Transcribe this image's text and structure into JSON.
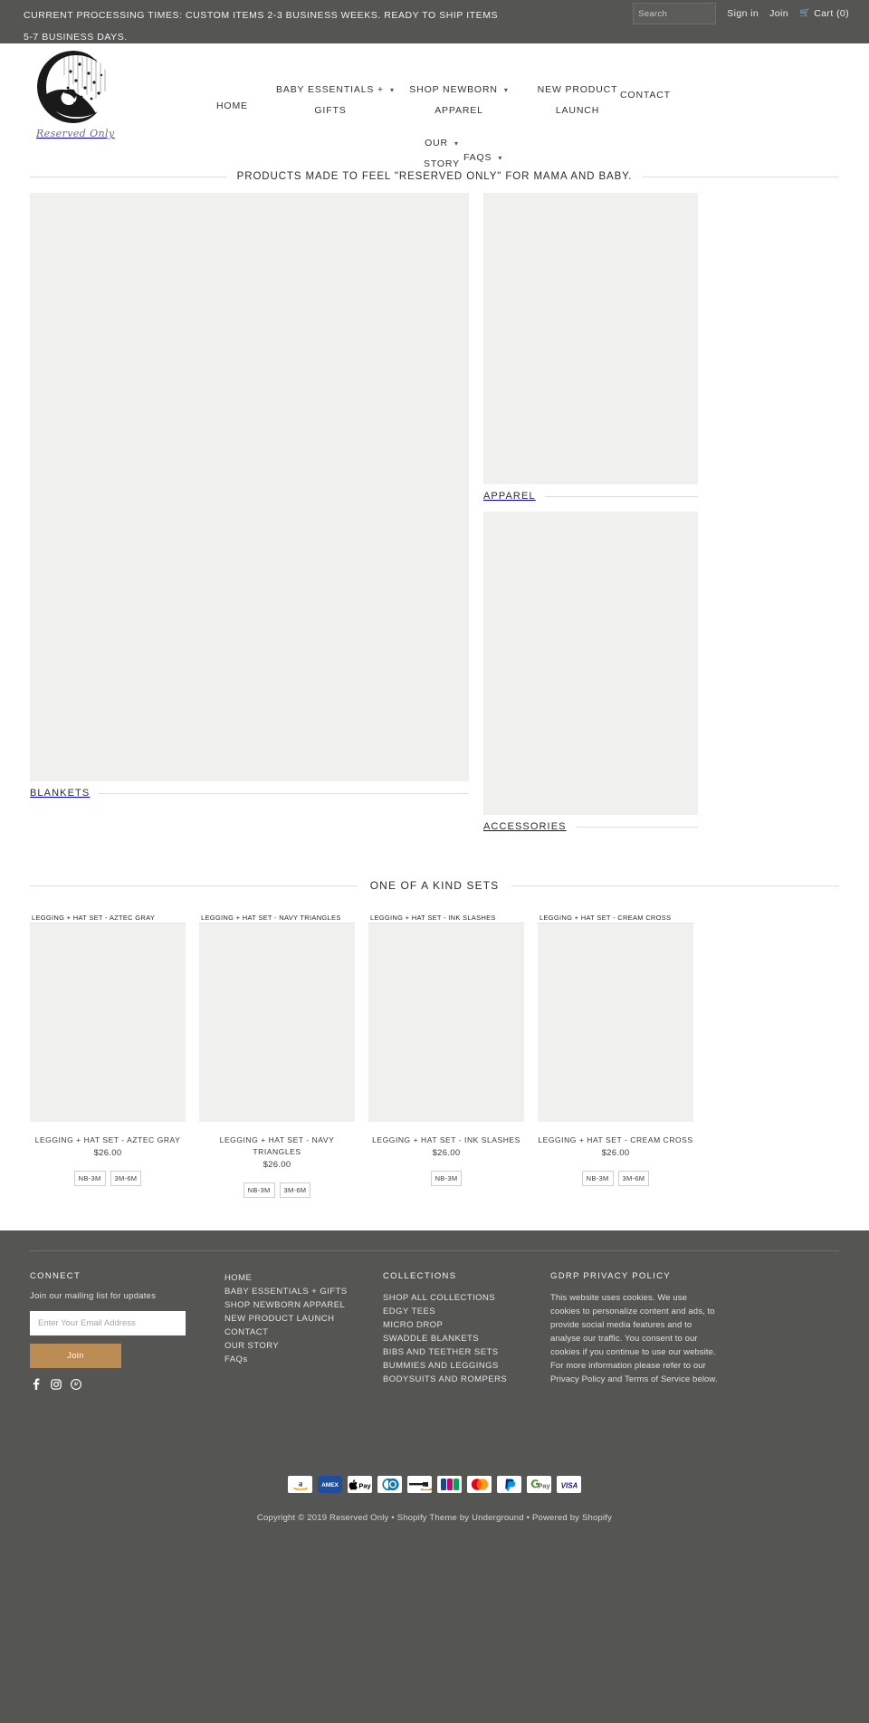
{
  "announcement": {
    "line1": "CURRENT PROCESSING TIMES: CUSTOM ITEMS 2-3 BUSINESS WEEKS. READY TO SHIP ITEMS",
    "line2": "5-7 BUSINESS DAYS.",
    "search_placeholder": "Search",
    "search_value": "",
    "sign_in": "Sign in",
    "join": "Join",
    "cart": "Cart (0)",
    "bar_color": "#555554"
  },
  "logo": {
    "script": "Reserved Only",
    "alt": "moon-and-baby-logo"
  },
  "nav": {
    "items": [
      {
        "label": "HOME",
        "caret": false
      },
      {
        "label": "BABY ESSENTIALS + GIFTS",
        "caret": true
      },
      {
        "label": "SHOP NEWBORN APPAREL",
        "caret": true
      },
      {
        "label": "NEW PRODUCT LAUNCH",
        "caret": false
      },
      {
        "label": "CONTACT",
        "caret": false
      },
      {
        "label": "OUR STORY",
        "caret": true
      },
      {
        "label": "FAQS",
        "caret": true
      }
    ]
  },
  "tagline": "PRODUCTS MADE TO FEEL \"RESERVED ONLY\" FOR MAMA AND BABY.",
  "collections": [
    {
      "label": "BLANKETS"
    },
    {
      "label": "APPAREL"
    },
    {
      "label": "ACCESSORIES"
    }
  ],
  "featured": {
    "title": "ONE OF A KIND SETS",
    "products": [
      {
        "quickview": "LEGGING + HAT SET - AZTEC GRAY",
        "title": "LEGGING + HAT SET - AZTEC GRAY",
        "price": "$26.00",
        "sizes": [
          "NB-3M",
          "3M-6M"
        ]
      },
      {
        "quickview": "LEGGING + HAT SET - NAVY TRIANGLES",
        "title": "LEGGING + HAT SET - NAVY TRIANGLES",
        "price": "$26.00",
        "sizes": [
          "NB-3M",
          "3M-6M"
        ]
      },
      {
        "quickview": "LEGGING + HAT SET - INK SLASHES",
        "title": "LEGGING + HAT SET - INK SLASHES",
        "price": "$26.00",
        "sizes": [
          "NB-3M"
        ]
      },
      {
        "quickview": "LEGGING + HAT SET - CREAM CROSS",
        "title": "LEGGING + HAT SET - CREAM CROSS",
        "price": "$26.00",
        "sizes": [
          "NB-3M",
          "3M-6M"
        ]
      }
    ]
  },
  "footer": {
    "connect": {
      "title": "CONNECT",
      "subtitle": "Join our mailing list for updates",
      "email_placeholder": "Enter Your Email Address",
      "email_value": "",
      "join_label": "Join",
      "socials": [
        "facebook-icon",
        "instagram-icon",
        "pinterest-icon"
      ]
    },
    "links": [
      "HOME",
      "BABY ESSENTIALS + GIFTS",
      "SHOP NEWBORN APPAREL",
      "NEW PRODUCT LAUNCH",
      "CONTACT",
      "OUR STORY",
      "FAQs"
    ],
    "collections": {
      "title": "COLLECTIONS",
      "items": [
        "SHOP ALL COLLECTIONS",
        "EDGY TEES",
        "MICRO DROP",
        "SWADDLE BLANKETS",
        "BIBS AND TEETHER SETS",
        "BUMMIES AND LEGGINGS",
        "BODYSUITS AND ROMPERS"
      ]
    },
    "gdpr": {
      "title": "GDRP PRIVACY POLICY",
      "body": "This website uses cookies. We use cookies to personalize content and ads, to provide social media features and to analyse our traffic. You consent to our cookies if you continue to use our website. For more information please refer to our Privacy Policy and Terms of Service below."
    },
    "payments": [
      "amazon-pay-icon",
      "amex-icon",
      "apple-pay-icon",
      "diners-club-icon",
      "discover-icon",
      "jcb-icon",
      "mastercard-icon",
      "paypal-icon",
      "google-pay-icon",
      "visa-icon"
    ],
    "copyright": "Copyright © 2019 Reserved Only • Shopify Theme by Underground • Powered by Shopify",
    "accent_color": "#ba8c54",
    "bg_color": "#555554"
  }
}
